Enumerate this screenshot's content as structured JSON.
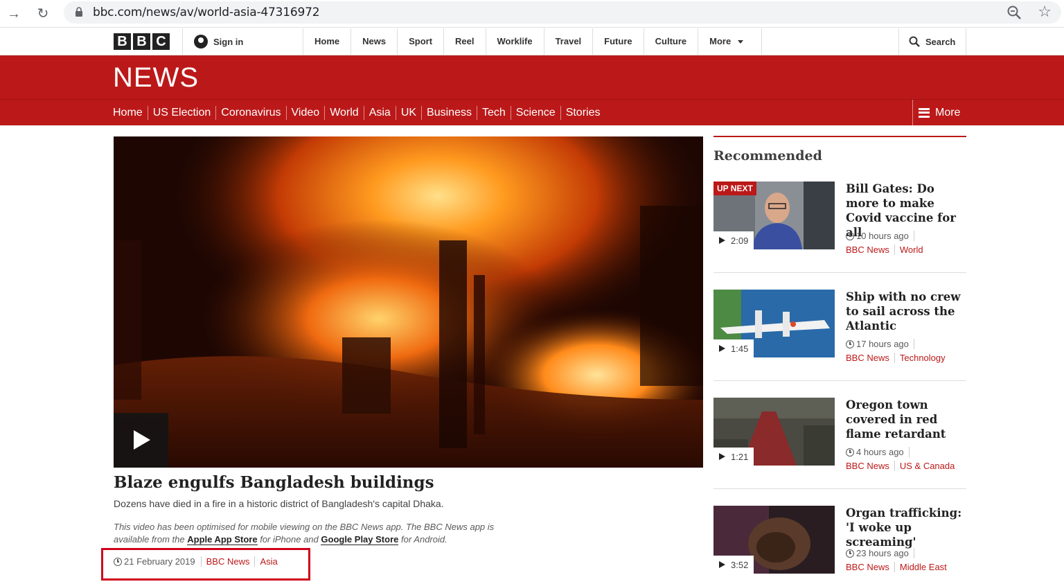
{
  "browser": {
    "url": "bbc.com/news/av/world-asia-47316972"
  },
  "global_nav": {
    "logo_letters": [
      "B",
      "B",
      "C"
    ],
    "sign_in": "Sign in",
    "items": [
      "Home",
      "News",
      "Sport",
      "Reel",
      "Worklife",
      "Travel",
      "Future",
      "Culture",
      "More"
    ],
    "search": "Search"
  },
  "masthead": {
    "wordmark": "NEWS"
  },
  "news_nav": {
    "items": [
      "Home",
      "US Election",
      "Coronavirus",
      "Video",
      "World",
      "Asia",
      "UK",
      "Business",
      "Tech",
      "Science",
      "Stories"
    ],
    "more": "More"
  },
  "article": {
    "headline": "Blaze engulfs Bangladesh buildings",
    "summary": "Dozens have died in a fire in a historic district of Bangladesh's capital Dhaka.",
    "app_note_1": "This video has been optimised for mobile viewing on the BBC News app. The BBC News app is available from the ",
    "app_store": "Apple App Store",
    "app_note_2": " for iPhone and ",
    "play_store": "Google Play Store",
    "app_note_3": " for Android.",
    "date": "21 February 2019",
    "source": "BBC News",
    "section": "Asia"
  },
  "sidebar": {
    "title": "Recommended",
    "up_next_label": "UP NEXT",
    "items": [
      {
        "title": "Bill Gates: Do more to make Covid vaccine for all",
        "duration": "2:09",
        "time": "10 hours ago",
        "source": "BBC News",
        "section": "World"
      },
      {
        "title": "Ship with no crew to sail across the Atlantic",
        "duration": "1:45",
        "time": "17 hours ago",
        "source": "BBC News",
        "section": "Technology"
      },
      {
        "title": "Oregon town covered in red flame retardant",
        "duration": "1:21",
        "time": "4 hours ago",
        "source": "BBC News",
        "section": "US & Canada"
      },
      {
        "title": "Organ trafficking: 'I woke up screaming'",
        "duration": "3:52",
        "time": "23 hours ago",
        "source": "BBC News",
        "section": "Middle East"
      }
    ]
  },
  "colors": {
    "bbc_red": "#bb1919",
    "highlight_box": "#d0021b"
  }
}
